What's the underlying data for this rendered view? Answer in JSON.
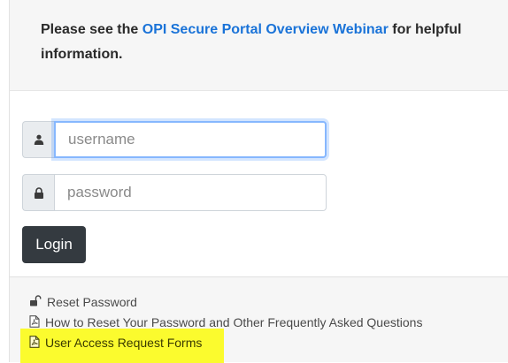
{
  "notice": {
    "prefix": "Please see the ",
    "link_text": "OPI Secure Portal Overview Webinar",
    "suffix": " for helpful information."
  },
  "login_form": {
    "username_placeholder": "username",
    "password_placeholder": "password",
    "login_label": "Login"
  },
  "footer": {
    "links": [
      {
        "label": "Reset Password",
        "icon": "unlock-icon"
      },
      {
        "label": "How to Reset Your Password and Other Frequently Asked Questions",
        "icon": "pdf-file-icon"
      },
      {
        "label": "User Access Request Forms",
        "icon": "pdf-file-icon",
        "highlighted": true
      }
    ]
  },
  "colors": {
    "link_blue": "#1a73d8",
    "button_dark": "#343a40",
    "highlight_yellow": "#fbfb2e",
    "focus_blue": "#86b7fe"
  }
}
